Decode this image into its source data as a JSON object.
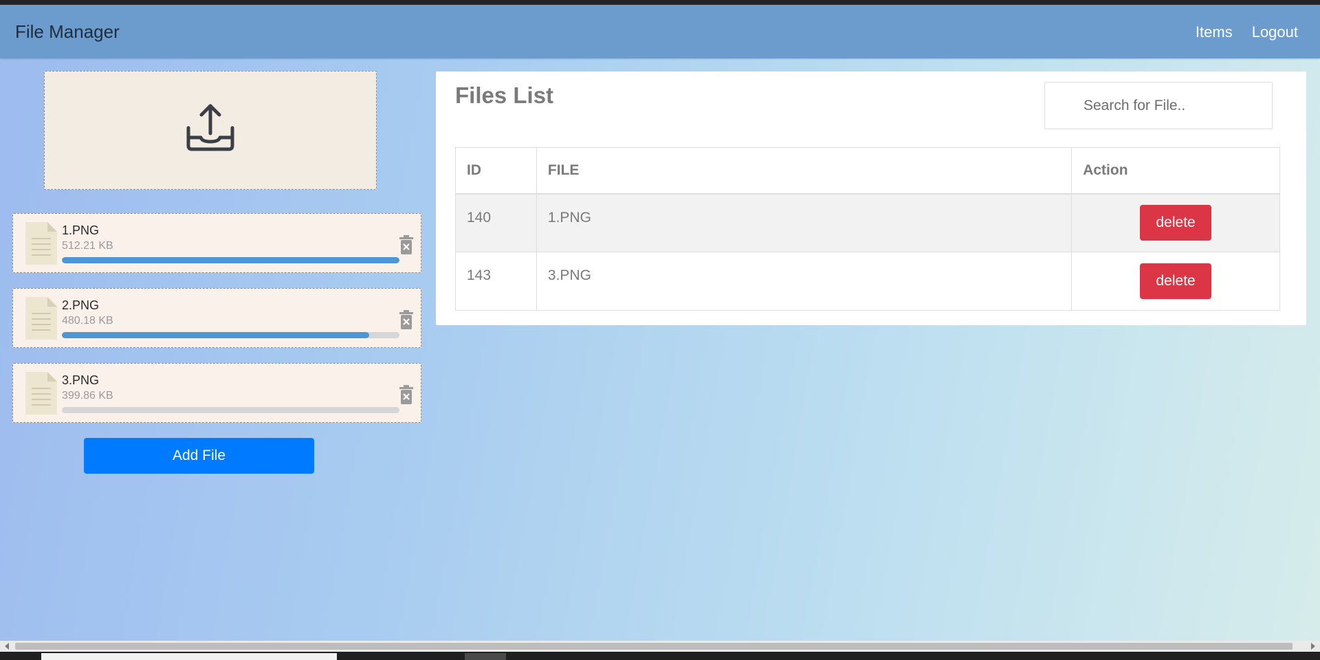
{
  "app": {
    "brand": "File Manager",
    "nav": [
      {
        "label": "Items"
      },
      {
        "label": "Logout"
      }
    ]
  },
  "upload": {
    "dropzone_icon": "upload-tray-icon",
    "items": [
      {
        "name": "1.PNG",
        "size": "512.21 KB",
        "progress": 1.0,
        "icon": "document-icon",
        "remove_icon": "trash-icon"
      },
      {
        "name": "2.PNG",
        "size": "480.18 KB",
        "progress": 0.91,
        "icon": "document-icon",
        "remove_icon": "trash-icon"
      },
      {
        "name": "3.PNG",
        "size": "399.86 KB",
        "progress": 0.0,
        "icon": "document-icon",
        "remove_icon": "trash-icon"
      }
    ],
    "add_label": "Add File"
  },
  "files_panel": {
    "title": "Files List",
    "search_placeholder": "Search for File..",
    "columns": [
      "ID",
      "FILE",
      "Action"
    ],
    "rows": [
      {
        "id": "140",
        "file": "1.PNG",
        "action": "delete"
      },
      {
        "id": "143",
        "file": "3.PNG",
        "action": "delete"
      }
    ]
  },
  "colors": {
    "navbar": "#6b9ccd",
    "primary": "#007bff",
    "danger": "#dc3545",
    "progress": "#4a97d3"
  }
}
